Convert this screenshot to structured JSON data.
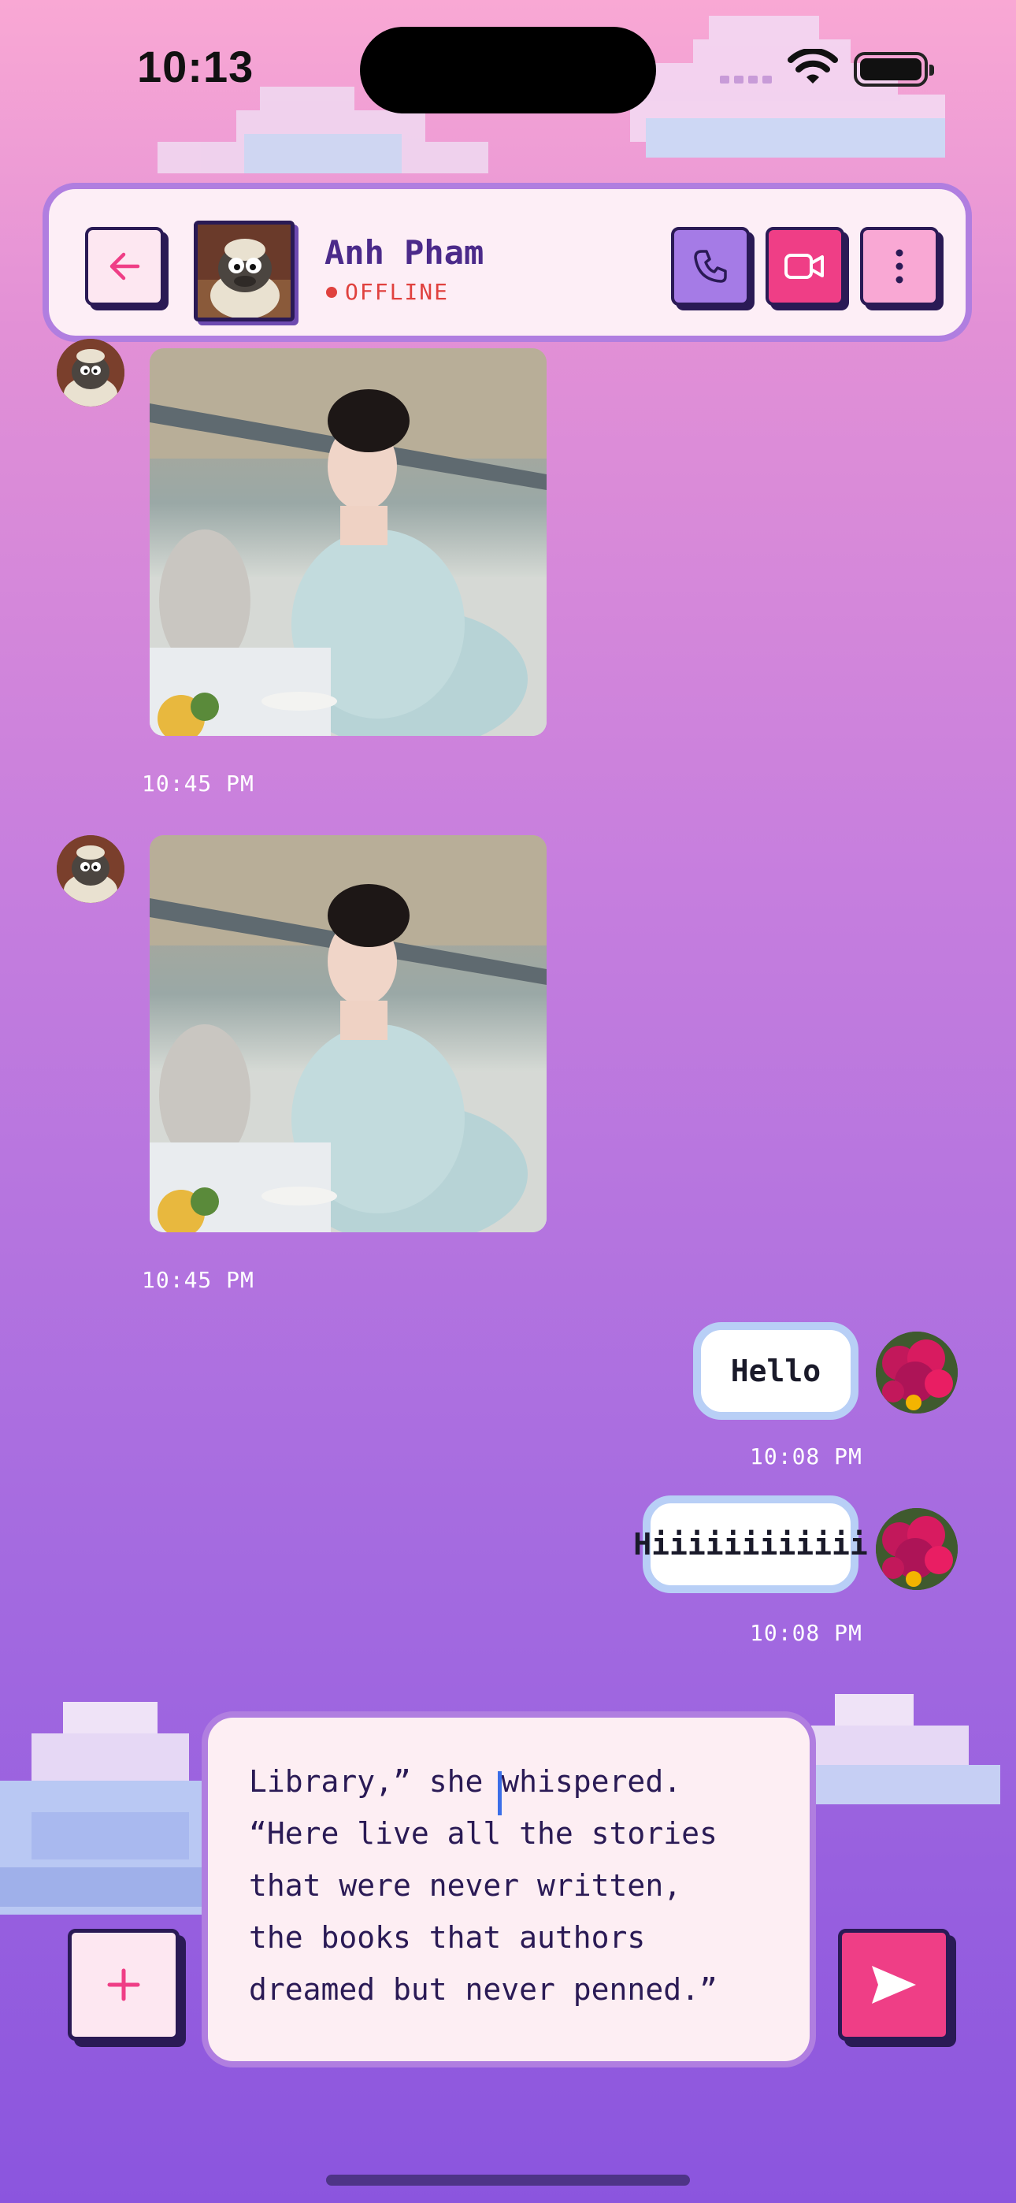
{
  "status_bar": {
    "time": "10:13"
  },
  "header": {
    "contact_name": "Anh Pham",
    "status": "OFFLINE",
    "back_icon": "arrow-left-icon",
    "call_icon": "phone-icon",
    "video_icon": "video-camera-icon",
    "more_icon": "more-vertical-icon"
  },
  "messages": [
    {
      "side": "received",
      "kind": "image",
      "timestamp": "10:45 PM"
    },
    {
      "side": "received",
      "kind": "image",
      "timestamp": "10:45 PM"
    },
    {
      "side": "sent",
      "kind": "text",
      "text": "Hello",
      "timestamp": "10:08 PM"
    },
    {
      "side": "sent",
      "kind": "text",
      "text": "Hiiiiiiiiiiii",
      "timestamp": "10:08 PM"
    }
  ],
  "composer": {
    "text": "Library,” she whispered.\n“Here live all the stories\nthat were never written,\nthe books that authors\ndreamed but never penned.”",
    "add_icon": "plus-icon",
    "send_icon": "send-icon"
  },
  "colors": {
    "accent_pink": "#ef3e86",
    "accent_purple": "#a57be6",
    "outline": "#2a1a55",
    "offline": "#e0413e"
  }
}
